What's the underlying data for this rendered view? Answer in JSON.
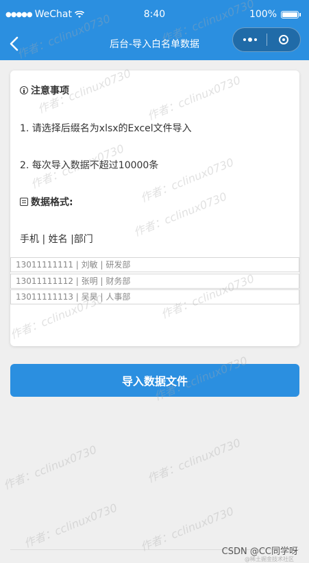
{
  "status_bar": {
    "carrier": "WeChat",
    "time": "8:40",
    "battery": "100%"
  },
  "nav": {
    "title": "后台-导入白名单数据"
  },
  "notice": {
    "heading": "注意事项",
    "rules": [
      "1. 请选择后缀名为xlsx的Excel文件导入",
      "2. 每次导入数据不超过10000条"
    ]
  },
  "format": {
    "heading": "数据格式:",
    "columns_text": "手机 | 姓名 |部门",
    "examples": [
      "13011111111 | 刘敏 | 研发部",
      "13011111112 | 张明 | 财务部",
      "13011111113 | 吴昊 | 人事部"
    ]
  },
  "import_button": {
    "label": "导入数据文件"
  },
  "watermark": {
    "text": "作者：cclinux0730",
    "source_mark": "CSDN @CC同学呀",
    "source_sub": "@稀土掘金技术社区"
  },
  "colors": {
    "brand_blue": "#2b8fe0",
    "background": "#efefef"
  }
}
